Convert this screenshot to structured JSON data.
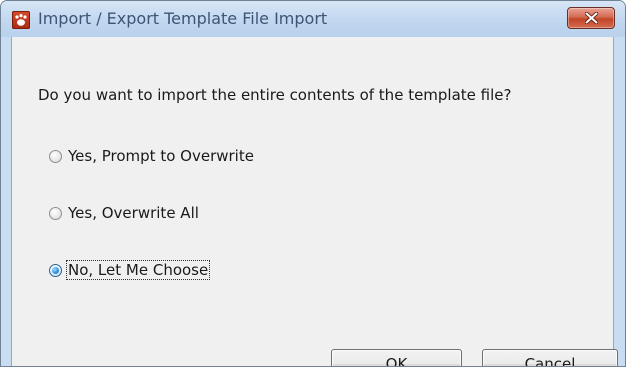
{
  "window": {
    "title": "Import / Export Template File Import",
    "icon": "app-icon",
    "close_icon": "close-icon"
  },
  "dialog": {
    "question": "Do you want to import the entire contents of the template file?",
    "options": [
      {
        "label": "Yes, Prompt to Overwrite",
        "selected": false
      },
      {
        "label": "Yes, Overwrite All",
        "selected": false
      },
      {
        "label": "No, Let Me Choose",
        "selected": true
      }
    ],
    "ok_label": "OK",
    "cancel_label": "Cancel"
  },
  "colors": {
    "title_text": "#3d5575",
    "close_button": "#c24628",
    "dialog_background": "#f0f0f0",
    "selected_radio": "#2f95dd"
  }
}
